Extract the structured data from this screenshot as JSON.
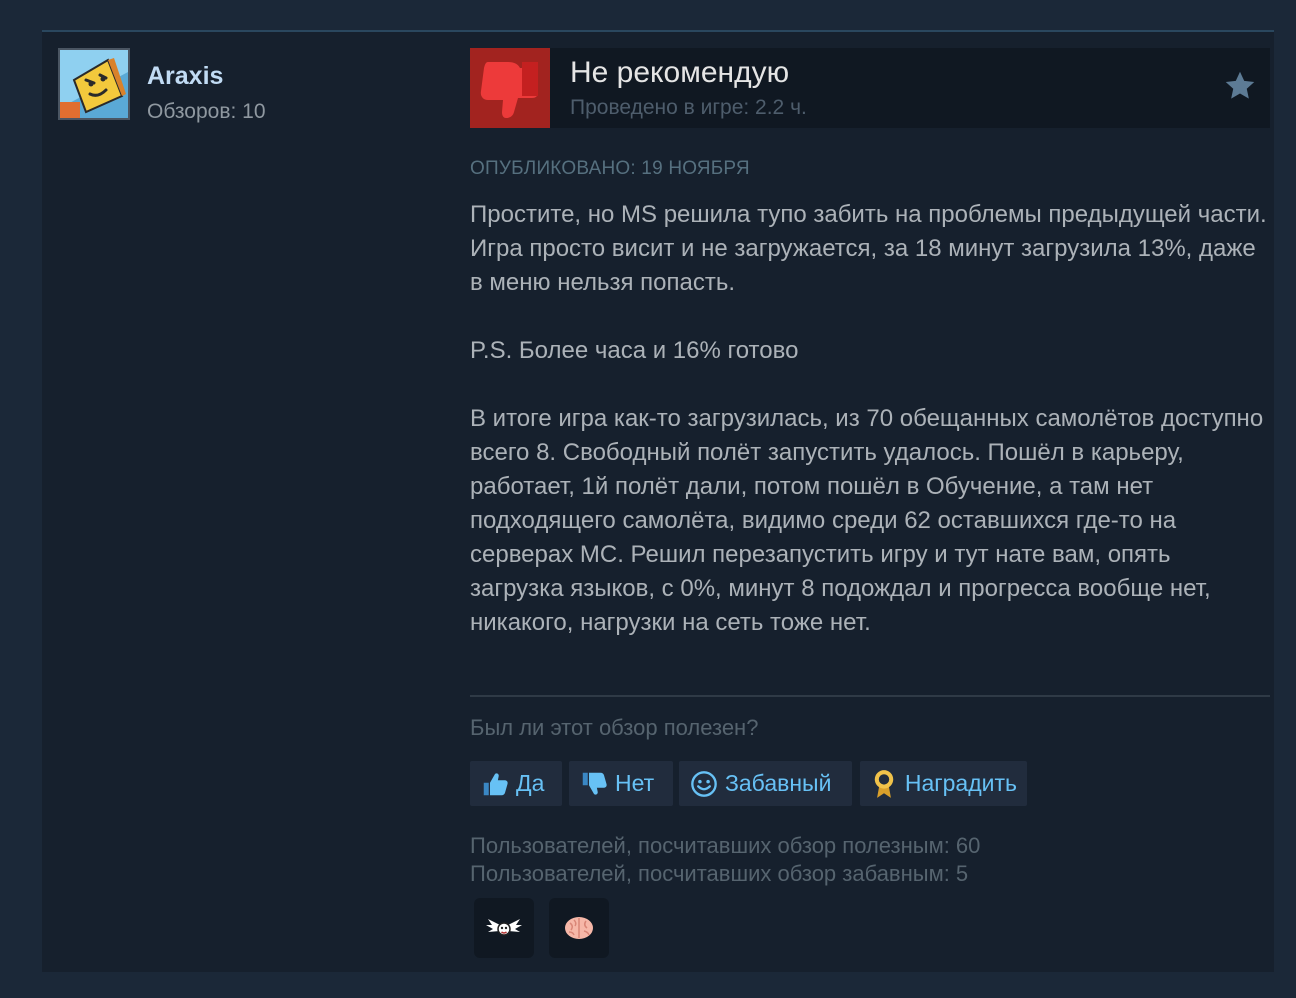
{
  "author": {
    "name": "Araxis",
    "reviews": "Обзоров: 10"
  },
  "review": {
    "verdict": "Не рекомендую",
    "hours": "Проведено в игре: 2.2 ч.",
    "posted": "ОПУБЛИКОВАНО: 19 НОЯБРЯ",
    "paragraphs": [
      "Простите, но MS решила тупо забить на проблемы предыдущей части. Игра просто висит и не загружается, за 18 минут загрузила 13%, даже в меню нельзя попасть.",
      "P.S. Более часа и 16% готово",
      "В итоге игра как-то загрузилась, из 70 обещанных самолётов доступно всего 8. Свободный полёт запустить удалось. Пошёл в карьеру, работает, 1й полёт дали, потом пошёл в Обучение, а там нет подходящего самолёта, видимо среди 62 оставшихся где-то на серверах MC. Решил перезапустить игру и тут нате вам, опять загрузка языков, с 0%, минут 8 подождал и прогресса вообще нет, никакого, нагрузки на сеть тоже нет."
    ]
  },
  "feedback": {
    "question": "Был ли этот обзор полезен?",
    "yes_label": "Да",
    "no_label": "Нет",
    "funny_label": "Забавный",
    "award_label": "Наградить",
    "helpful_count": "Пользователей, посчитавших обзор полезным: 60",
    "funny_count": "Пользователей, посчитавших обзор забавным: 5"
  },
  "colors": {
    "page_bg": "#1b2838",
    "card_bg": "#16202d",
    "negative": "#a2231f",
    "link": "#67c1f5",
    "author": "#c1dbf4"
  },
  "icons": {
    "verdict": "thumbs-down-icon",
    "favorite": "star-icon",
    "yes": "thumbs-up-icon",
    "no": "thumbs-down-icon",
    "funny": "smiley-icon",
    "award": "award-ribbon-icon",
    "awards_received": [
      "winged-award-icon",
      "brain-award-icon"
    ]
  }
}
